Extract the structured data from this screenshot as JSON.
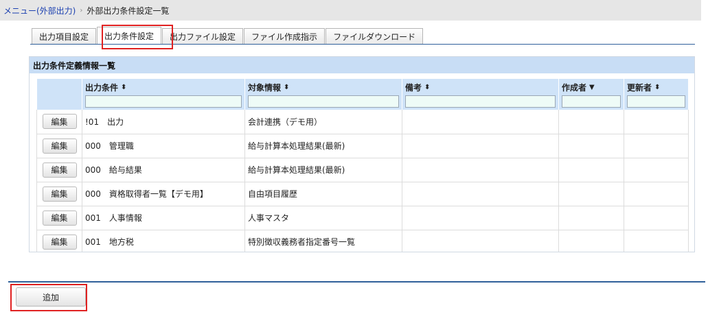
{
  "breadcrumb": {
    "menu_link": "メニュー(外部出力)",
    "separator": "›",
    "current": "外部出力条件設定一覧"
  },
  "tabs": [
    {
      "label": "出力項目設定"
    },
    {
      "label": "出力条件設定"
    },
    {
      "label": "出力ファイル設定"
    },
    {
      "label": "ファイル作成指示"
    },
    {
      "label": "ファイルダウンロード"
    }
  ],
  "active_tab": "出力条件設定",
  "panel": {
    "title": "出力条件定義情報一覧"
  },
  "table": {
    "headers": {
      "condition": "出力条件",
      "target": "対象情報",
      "note": "備考",
      "creator": "作成者",
      "updater": "更新者"
    },
    "sort_icons": {
      "condition": "⬍",
      "target": "⬍",
      "note": "⬍",
      "creator": "▼",
      "updater": "⬍"
    },
    "edit_label": "編集",
    "rows": [
      {
        "condition": "!01　出力",
        "target": "会計連携（デモ用）",
        "note": "",
        "creator": "",
        "updater": ""
      },
      {
        "condition": "000　管理職",
        "target": "給与計算本処理結果(最新)",
        "note": "",
        "creator": "",
        "updater": ""
      },
      {
        "condition": "000　給与結果",
        "target": "給与計算本処理結果(最新)",
        "note": "",
        "creator": "",
        "updater": ""
      },
      {
        "condition": "000　資格取得者一覧【デモ用】",
        "target": "自由項目履歴",
        "note": "",
        "creator": "",
        "updater": ""
      },
      {
        "condition": "001　人事情報",
        "target": "人事マスタ",
        "note": "",
        "creator": "",
        "updater": ""
      },
      {
        "condition": "001　地方税",
        "target": "特別徴収義務者指定番号一覧",
        "note": "",
        "creator": "",
        "updater": ""
      }
    ]
  },
  "add_button": "追加",
  "colors": {
    "highlight": "#e02020",
    "header_bg": "#c8ddf5",
    "filter_bg": "#eefbf7"
  }
}
